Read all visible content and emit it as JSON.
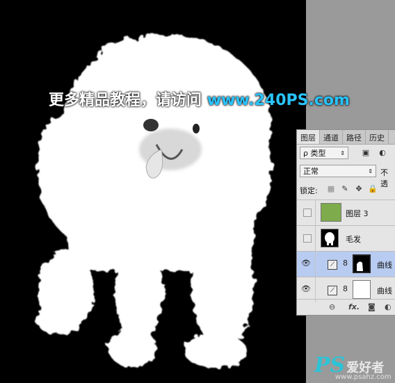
{
  "watermark": {
    "text": "更多精品教程，请访问",
    "url": "www.240PS.com"
  },
  "layers_panel": {
    "tabs": [
      "图层",
      "通道",
      "路径",
      "历史"
    ],
    "filter_select": "ρ 类型",
    "blend_mode": "正常",
    "opacity_label": "不透",
    "lock_label": "锁定:",
    "layers": [
      {
        "name": "图层 3",
        "visible": false,
        "thumb_color": "#7eab4c",
        "selected": false
      },
      {
        "name": "毛发",
        "visible": false,
        "thumb_color": "#000000",
        "selected": false
      },
      {
        "name": "曲线",
        "visible": true,
        "thumb_color": "#ffffff",
        "selected": true
      },
      {
        "name": "曲线",
        "visible": true,
        "thumb_color": "#ffffff",
        "selected": false
      }
    ],
    "bottom_icons": [
      "link-icon",
      "fx-icon",
      "mask-icon",
      "adjustment-icon"
    ]
  },
  "logo": {
    "ps": "PS",
    "cn": "爱好者",
    "url": "www.psahz.com"
  }
}
